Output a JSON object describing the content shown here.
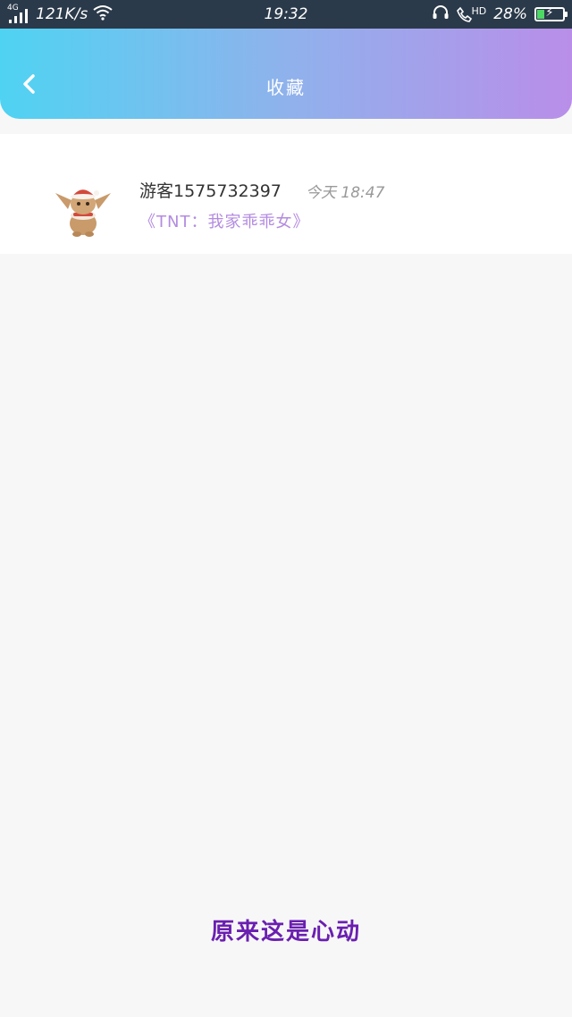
{
  "status_bar": {
    "network": "4G",
    "speed": "121K/s",
    "time": "19:32",
    "call_badge": "HD",
    "battery": "28%",
    "battery_level": 0.28,
    "icons": [
      "signal-icon",
      "wifi-icon",
      "headphones-icon",
      "phone-hd-icon",
      "battery-charging-icon"
    ]
  },
  "header": {
    "title": "收藏",
    "back_icon": "chevron-left-icon"
  },
  "favorites": [
    {
      "user": "游客1575732397 ...",
      "time": "今天 18:47",
      "title": "《TNT：我家乖乖女》"
    }
  ],
  "watermark": "原来这是心动",
  "colors": {
    "status_bar": "#2b3a4a",
    "header_start": "#4fd3f2",
    "header_end": "#b98ee9",
    "title_accent": "#b38be0",
    "watermark": "#6a1fb0"
  }
}
